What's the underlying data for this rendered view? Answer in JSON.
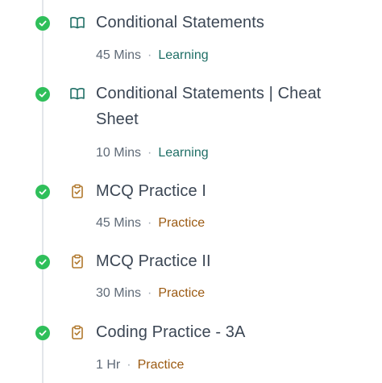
{
  "colors": {
    "check_green": "#2fbf5a",
    "learning_accent": "#1f6f66",
    "practice_accent": "#b0782c",
    "title_text": "#3b4654",
    "timeline": "#e3e6ea"
  },
  "items": [
    {
      "title": "Conditional Statements",
      "duration": "45 Mins",
      "category": "Learning",
      "completed": true,
      "type_icon": "book-icon"
    },
    {
      "title": "Conditional Statements | Cheat Sheet",
      "duration": "10 Mins",
      "category": "Learning",
      "completed": true,
      "type_icon": "book-icon"
    },
    {
      "title": "MCQ Practice I",
      "duration": "45 Mins",
      "category": "Practice",
      "completed": true,
      "type_icon": "clipboard-check-icon"
    },
    {
      "title": "MCQ Practice II",
      "duration": "30 Mins",
      "category": "Practice",
      "completed": true,
      "type_icon": "clipboard-check-icon"
    },
    {
      "title": "Coding Practice - 3A",
      "duration": "1 Hr",
      "category": "Practice",
      "completed": true,
      "type_icon": "clipboard-check-icon"
    }
  ]
}
